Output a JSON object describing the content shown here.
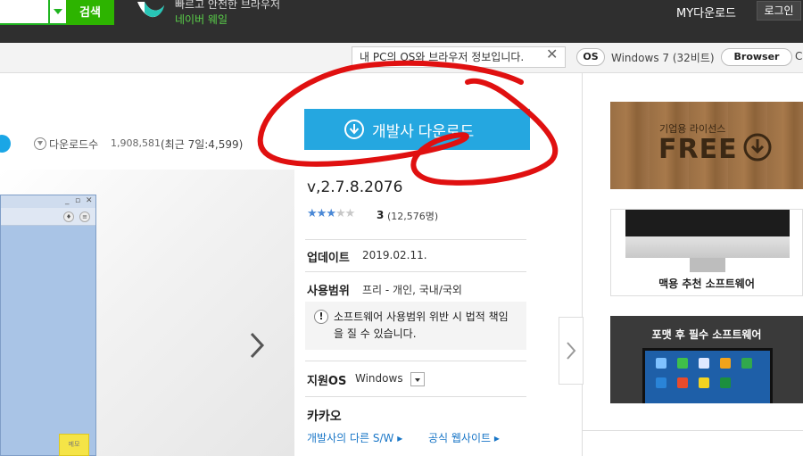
{
  "topbar": {
    "search_button": "검색",
    "promo_title": "빠르고 안전한 브라우저",
    "promo_subtitle": "네이버 웨일",
    "my_download": "MY다운로드",
    "login": "로그인"
  },
  "infobar": {
    "tip_text": "내 PC의 OS와 브라우저 정보입니다.",
    "os_chip": "OS",
    "os_value": "Windows 7 (32비트)",
    "browser_chip": "Browser",
    "cut_text": "C"
  },
  "stats": {
    "download_label": "다운로드수",
    "download_count": "1,908,581",
    "recent": "(최근 7일:4,599)"
  },
  "app_preview": {
    "window_controls": [
      "_",
      "▫",
      "✕"
    ],
    "yellow_label": "메모"
  },
  "download_button": {
    "label": "개발사 다운로드"
  },
  "details": {
    "version": "v,2.7.8.2076",
    "rating": {
      "value": 3,
      "max": 5,
      "score_text": "3",
      "count_text": "(12,576명)"
    },
    "update_label": "업데이트",
    "update_value": "2019.02.11.",
    "scope_label": "사용범위",
    "scope_value": "프리 - 개인, 국내/국외",
    "warning": "소프트웨어 사용범위 위반 시 법적 책임을 질 수 있습니다.",
    "os_label": "지원OS",
    "os_value": "Windows",
    "company": "카카오",
    "link_other": "개발사의 다른 S/W",
    "link_site": "공식 웹사이트"
  },
  "banners": {
    "wood_small": "기업용 라이선스",
    "wood_big": "FREE",
    "mac_caption": "맥용 추천 소프트웨어",
    "fmt_caption": "포맷 후 필수 소프트웨어"
  },
  "colors": {
    "accent_blue": "#25a7e0",
    "search_green": "#2db400",
    "scribble_red": "#e01010",
    "link_blue": "#1976c7"
  }
}
